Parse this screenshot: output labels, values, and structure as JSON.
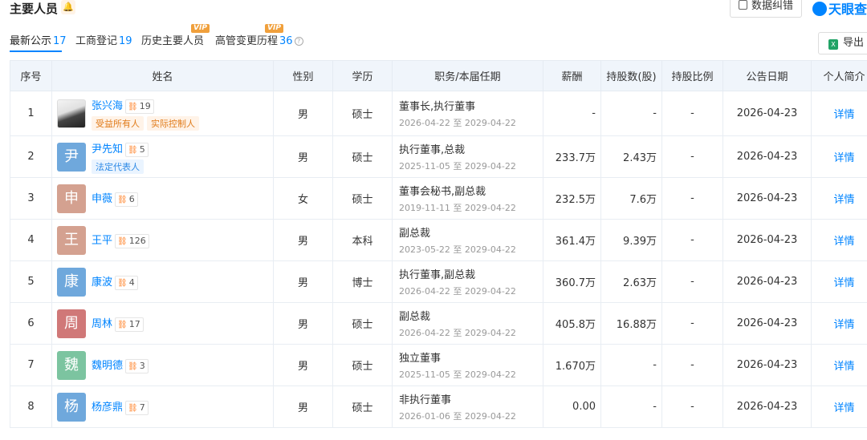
{
  "header": {
    "title": "主要人员",
    "correct_label": "数据纠错",
    "brand": "天眼查"
  },
  "tabs": [
    {
      "label": "最新公示",
      "count": "17",
      "vip": ""
    },
    {
      "label": "工商登记",
      "count": "19",
      "vip": ""
    },
    {
      "label": "历史主要人员",
      "count": "",
      "vip": "VIP"
    },
    {
      "label": "高管变更历程",
      "count": "36",
      "vip": "VIP"
    }
  ],
  "export_label": "导出",
  "table": {
    "columns": [
      "序号",
      "姓名",
      "性别",
      "学历",
      "职务/本届任期",
      "薪酬",
      "持股数(股)",
      "持股比例",
      "公告日期",
      "个人简介"
    ],
    "rows": [
      {
        "no": "1",
        "avatar": "",
        "avatar_color": "",
        "name": "张兴海",
        "rel": "19",
        "tags": [
          "受益所有人",
          "实际控制人"
        ],
        "blue_tag": "",
        "gender": "男",
        "edu": "硕士",
        "title": "董事长,执行董事",
        "term": "2026-04-22 至 2029-04-22",
        "salary": "-",
        "shares": "-",
        "ratio": "-",
        "date": "2026-04-23",
        "detail": "详情"
      },
      {
        "no": "2",
        "avatar": "尹",
        "avatar_color": "#6fa8dc",
        "name": "尹先知",
        "rel": "5",
        "tags": [],
        "blue_tag": "法定代表人",
        "gender": "男",
        "edu": "硕士",
        "title": "执行董事,总裁",
        "term": "2025-11-05 至 2029-04-22",
        "salary": "233.7万",
        "shares": "2.43万",
        "ratio": "-",
        "date": "2026-04-23",
        "detail": "详情"
      },
      {
        "no": "3",
        "avatar": "申",
        "avatar_color": "#d4a190",
        "name": "申薇",
        "rel": "6",
        "tags": [],
        "blue_tag": "",
        "gender": "女",
        "edu": "硕士",
        "title": "董事会秘书,副总裁",
        "term": "2019-11-11 至 2029-04-22",
        "salary": "232.5万",
        "shares": "7.6万",
        "ratio": "-",
        "date": "2026-04-23",
        "detail": "详情"
      },
      {
        "no": "4",
        "avatar": "王",
        "avatar_color": "#d4a190",
        "name": "王平",
        "rel": "126",
        "tags": [],
        "blue_tag": "",
        "gender": "男",
        "edu": "本科",
        "title": "副总裁",
        "term": "2023-05-22 至 2029-04-22",
        "salary": "361.4万",
        "shares": "9.39万",
        "ratio": "-",
        "date": "2026-04-23",
        "detail": "详情"
      },
      {
        "no": "5",
        "avatar": "康",
        "avatar_color": "#6fa8dc",
        "name": "康波",
        "rel": "4",
        "tags": [],
        "blue_tag": "",
        "gender": "男",
        "edu": "博士",
        "title": "执行董事,副总裁",
        "term": "2026-04-22 至 2029-04-22",
        "salary": "360.7万",
        "shares": "2.63万",
        "ratio": "-",
        "date": "2026-04-23",
        "detail": "详情"
      },
      {
        "no": "6",
        "avatar": "周",
        "avatar_color": "#d07878",
        "name": "周林",
        "rel": "17",
        "tags": [],
        "blue_tag": "",
        "gender": "男",
        "edu": "硕士",
        "title": "副总裁",
        "term": "2026-04-22 至 2029-04-22",
        "salary": "405.8万",
        "shares": "16.88万",
        "ratio": "-",
        "date": "2026-04-23",
        "detail": "详情"
      },
      {
        "no": "7",
        "avatar": "魏",
        "avatar_color": "#7cc4a0",
        "name": "魏明德",
        "rel": "3",
        "tags": [],
        "blue_tag": "",
        "gender": "男",
        "edu": "硕士",
        "title": "独立董事",
        "term": "2025-11-05 至 2029-04-22",
        "salary": "1.670万",
        "shares": "-",
        "ratio": "-",
        "date": "2026-04-23",
        "detail": "详情"
      },
      {
        "no": "8",
        "avatar": "杨",
        "avatar_color": "#6fa8dc",
        "name": "杨彦鼎",
        "rel": "7",
        "tags": [],
        "blue_tag": "",
        "gender": "男",
        "edu": "硕士",
        "title": "非执行董事",
        "term": "2026-01-06 至 2029-04-22",
        "salary": "0.00",
        "shares": "-",
        "ratio": "-",
        "date": "2026-04-23",
        "detail": "详情"
      }
    ]
  }
}
